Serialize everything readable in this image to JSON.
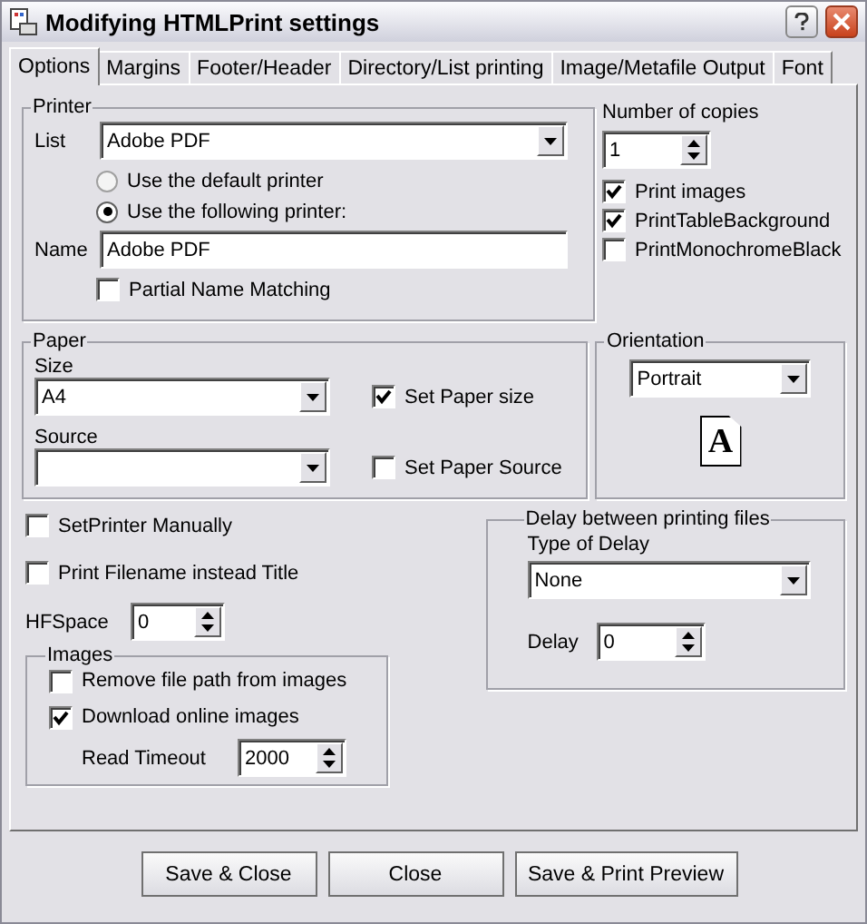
{
  "window": {
    "title": "Modifying HTMLPrint settings"
  },
  "tabs": [
    {
      "label": "Options",
      "selected": true
    },
    {
      "label": "Margins",
      "selected": false
    },
    {
      "label": "Footer/Header",
      "selected": false
    },
    {
      "label": "Directory/List printing",
      "selected": false
    },
    {
      "label": "Image/Metafile Output",
      "selected": false
    },
    {
      "label": "Font",
      "selected": false
    }
  ],
  "printer": {
    "title": "Printer",
    "list_label": "List",
    "list_value": "Adobe PDF",
    "radios": [
      {
        "label": "Use the default printer",
        "selected": false
      },
      {
        "label": "Use the following printer:",
        "selected": true
      }
    ],
    "name_label": "Name",
    "name_value": "Adobe PDF",
    "partial": {
      "label": "Partial Name Matching",
      "checked": false
    }
  },
  "copies": {
    "label": "Number of copies",
    "value": "1",
    "options": [
      {
        "label": "Print images",
        "checked": true
      },
      {
        "label": "PrintTableBackground",
        "checked": true
      },
      {
        "label": "PrintMonochromeBlack",
        "checked": false
      }
    ]
  },
  "paper": {
    "title": "Paper",
    "size_label": "Size",
    "size_value": "A4",
    "set_size": {
      "label": "Set Paper size",
      "checked": true
    },
    "source_label": "Source",
    "set_source": {
      "label": "Set Paper Source",
      "checked": false
    }
  },
  "orientation": {
    "title": "Orientation",
    "value": "Portrait",
    "icon_letter": "A"
  },
  "misc": [
    {
      "label": "SetPrinter Manually",
      "checked": false
    },
    {
      "label": "Print Filename instead Title",
      "checked": false
    }
  ],
  "hfspace": {
    "label": "HFSpace",
    "value": "0"
  },
  "images": {
    "title": "Images",
    "options": [
      {
        "label": "Remove file path from images",
        "checked": false
      },
      {
        "label": "Download online images",
        "checked": true
      }
    ],
    "timeout_label": "Read Timeout",
    "timeout_value": "2000"
  },
  "delay": {
    "title": "Delay between printing files",
    "type_label": "Type of Delay",
    "type_value": "None",
    "delay_label": "Delay",
    "delay_value": "0"
  },
  "buttons": [
    "Save & Close",
    "Close",
    "Save & Print Preview"
  ]
}
